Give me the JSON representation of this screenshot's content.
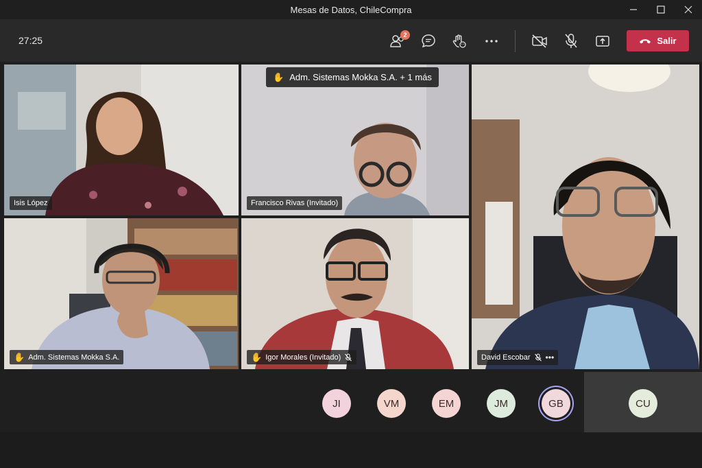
{
  "window": {
    "title": "Mesas de Datos, ChileCompra"
  },
  "toolbar": {
    "timer": "27:25",
    "participants_badge": "2",
    "leave_label": "Salir"
  },
  "raised_hands": {
    "text": "Adm. Sistemas Mokka S.A. + 1 más"
  },
  "tiles": [
    {
      "name": "Isis López"
    },
    {
      "name": "Francisco Rivas (Invitado)"
    },
    {
      "name": "David Escobar"
    },
    {
      "name": "Adm. Sistemas Mokka S.A."
    },
    {
      "name": "Igor Morales (Invitado)"
    }
  ],
  "avatars": [
    {
      "initials": "JI",
      "color": "#f2d3dd"
    },
    {
      "initials": "VM",
      "color": "#f5d6cc"
    },
    {
      "initials": "EM",
      "color": "#f5d4d4"
    },
    {
      "initials": "JM",
      "color": "#dcebdc"
    },
    {
      "initials": "GB",
      "color": "#f0d8dc",
      "speaking": true
    },
    {
      "initials": "CU",
      "color": "#e4ecdc"
    }
  ],
  "colors": {
    "leave": "#c4314b",
    "badge": "#e8735a",
    "speaking_ring": "#a5a4f2"
  }
}
